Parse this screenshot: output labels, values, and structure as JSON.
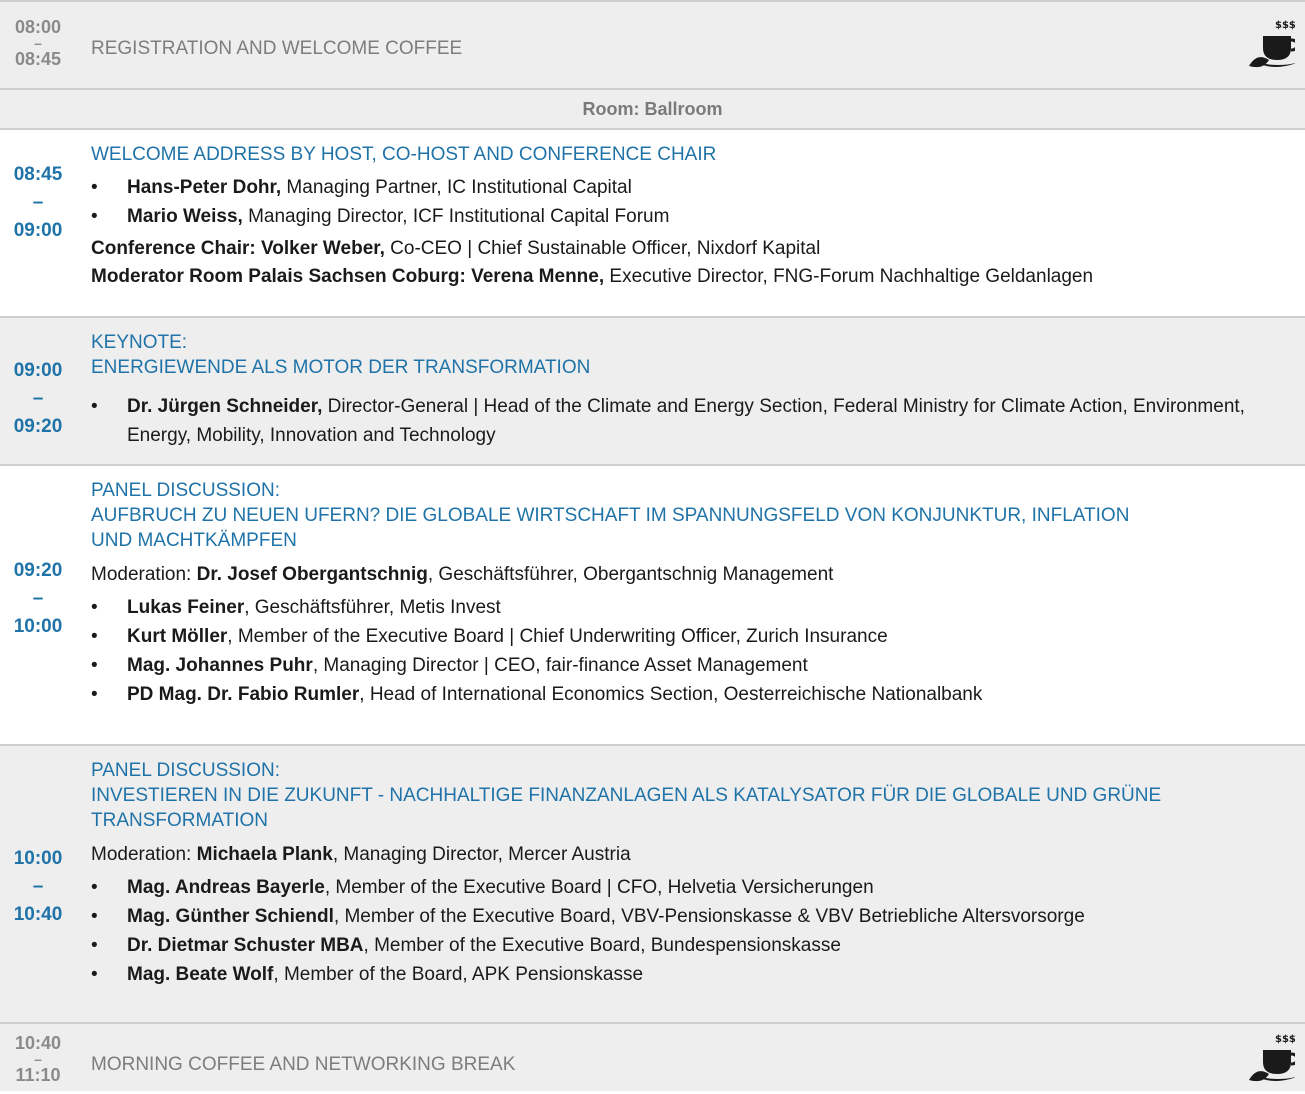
{
  "break1": {
    "time_start": "08:00",
    "time_end": "08:45",
    "title": "REGISTRATION AND WELCOME COFFEE"
  },
  "room": {
    "label": "Room: Ballroom"
  },
  "s1": {
    "time_start": "08:45",
    "time_end": "09:00",
    "title": "WELCOME ADDRESS BY HOST, CO-HOST AND CONFERENCE CHAIR",
    "speakers": [
      {
        "name": "Hans-Peter Dohr,",
        "role": " Managing Partner, IC Institutional Capital"
      },
      {
        "name": "Mario Weiss,",
        "role": " Managing Director, ICF Institutional Capital Forum"
      }
    ],
    "chair": {
      "name": "Conference Chair: Volker Weber,",
      "role": " Co-CEO | Chief Sustainable Officer, Nixdorf Kapital"
    },
    "moderator": {
      "name": "Moderator Room Palais Sachsen Coburg: Verena Menne,",
      "role": " Executive Director, FNG-Forum Nachhaltige Geldanlagen"
    }
  },
  "s2": {
    "time_start": "09:00",
    "time_end": "09:20",
    "title1": "KEYNOTE:",
    "title2": "ENERGIEWENDE ALS MOTOR DER TRANSFORMATION",
    "speakers": [
      {
        "name": "Dr. Jürgen Schneider,",
        "role": " Director-General | Head of the Climate and Energy Section, Federal Ministry for Climate Action, Environment, Energy, Mobility, Innovation and Technology"
      }
    ]
  },
  "s3": {
    "time_start": "09:20",
    "time_end": "10:00",
    "title1": "PANEL DISCUSSION:",
    "title2": "AUFBRUCH ZU NEUEN UFERN? DIE GLOBALE WIRTSCHAFT IM SPANNUNGSFELD VON KONJUNKTUR, INFLATION UND MACHTKÄMPFEN",
    "moderation_label": "Moderation: ",
    "moderation_name": "Dr. Josef Obergantschnig",
    "moderation_role": ", Geschäftsführer, Obergantschnig Management",
    "speakers": [
      {
        "name": "Lukas Feiner",
        "role": ", Geschäftsführer, Metis Invest"
      },
      {
        "name": "Kurt Möller",
        "role": ", Member of the Executive Board | Chief Underwriting Officer, Zurich Insurance"
      },
      {
        "name": "Mag. Johannes Puhr",
        "role": ", Managing Director | CEO, fair-finance Asset Management"
      },
      {
        "name": "PD Mag. Dr. Fabio Rumler",
        "role": ", Head of International Economics Section, Oesterreichische Nationalbank"
      }
    ]
  },
  "s4": {
    "time_start": "10:00",
    "time_end": "10:40",
    "title1": "PANEL DISCUSSION:",
    "title2": "INVESTIEREN IN DIE ZUKUNFT - NACHHALTIGE FINANZANLAGEN ALS KATALYSATOR FÜR DIE GLOBALE UND GRÜNE TRANSFORMATION",
    "moderation_label": "Moderation: ",
    "moderation_name": "Michaela Plank",
    "moderation_role": ", Managing Director, Mercer Austria",
    "speakers": [
      {
        "name": "Mag. Andreas Bayerle",
        "role": ", Member of the Executive Board | CFO, Helvetia Versicherungen"
      },
      {
        "name": "Mag. Günther Schiendl",
        "role": ", Member of the Executive Board, VBV-Pensionskasse & VBV Betriebliche Altersvorsorge"
      },
      {
        "name": "Dr. Dietmar Schuster MBA",
        "role": ", Member of the Executive Board, Bundespensionskasse"
      },
      {
        "name": "Mag. Beate Wolf",
        "role": ", Member of the Board, APK Pensionskasse"
      }
    ]
  },
  "break2": {
    "time_start": "10:40",
    "time_end": "11:10",
    "title": "MORNING COFFEE AND NETWORKING BREAK"
  },
  "dash": "–",
  "colors": {
    "accent": "#1f73a8",
    "band": "#eeeeee",
    "rule": "#cfcfcf"
  }
}
